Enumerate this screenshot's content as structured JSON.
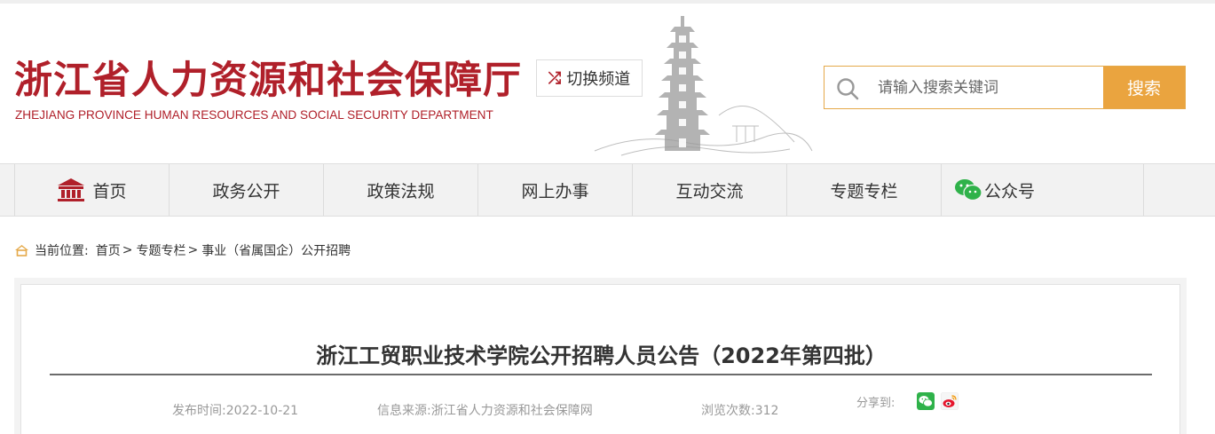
{
  "header": {
    "logo_cn": "浙江省人力资源和社会保障厅",
    "logo_en": "ZHEJIANG PROVINCE HUMAN RESOURCES AND SOCIAL SECURITY DEPARTMENT",
    "switch_label": "切换频道",
    "search_placeholder": "请输入搜索关键词",
    "search_button": "搜索"
  },
  "nav": {
    "items": [
      {
        "label": "首页",
        "icon": "building-icon"
      },
      {
        "label": "政务公开"
      },
      {
        "label": "政策法规"
      },
      {
        "label": "网上办事"
      },
      {
        "label": "互动交流"
      },
      {
        "label": "专题专栏"
      },
      {
        "label": "公众号",
        "icon": "wechat-icon"
      }
    ]
  },
  "breadcrumb": {
    "prefix": "当前位置:",
    "items": [
      "首页",
      "专题专栏",
      "事业（省属国企）公开招聘"
    ],
    "separator": ">"
  },
  "article": {
    "title": "浙江工贸职业技术学院公开招聘人员公告（2022年第四批）",
    "publish_time": "发布时间:2022-10-21",
    "source": "信息来源:浙江省人力资源和社会保障网",
    "views": "浏览次数:312",
    "share_label": "分享到:"
  },
  "colors": {
    "brand_red": "#b0202a",
    "search_orange": "#eaa43f",
    "wechat_green": "#2fb24a",
    "weibo_red": "#e6162d"
  }
}
